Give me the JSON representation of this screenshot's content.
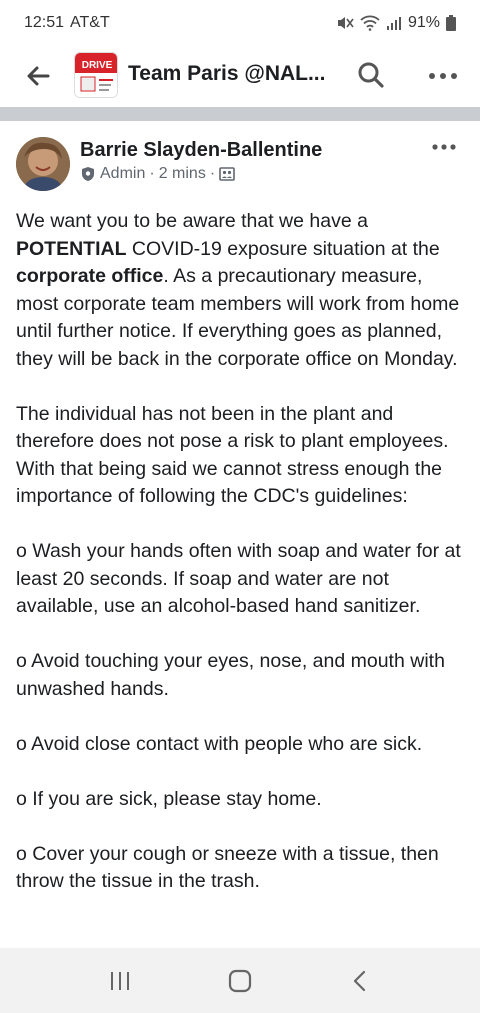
{
  "status_bar": {
    "time": "12:51",
    "carrier": "AT&T",
    "battery": "91%"
  },
  "app_bar": {
    "group_title": "Team Paris @NAL...",
    "group_thumb_text": "DRIVE"
  },
  "post": {
    "author": "Barrie Slayden-Ballentine",
    "role": "Admin",
    "time": "2 mins",
    "paragraphs": [
      {
        "pre": "We want you to be aware that we have a ",
        "b1": "POTENTIAL",
        "mid": " COVID-19 exposure situation at the ",
        "b2": "corporate office",
        "post": ".  As a precautionary measure, most corporate team members will work from home until further notice.  If everything goes as planned, they will be back in the corporate office on Monday."
      },
      {
        "text": "The individual has not been in the plant and therefore does not pose a risk to plant employees. With that being said we cannot stress enough the importance of following the CDC's guidelines:"
      },
      {
        "text": "o Wash your hands often with soap and water for at least 20 seconds. If soap and water are not available, use an alcohol-based hand sanitizer."
      },
      {
        "text": "o Avoid touching your eyes, nose, and mouth with unwashed hands."
      },
      {
        "text": "o Avoid close contact with people who are sick."
      },
      {
        "text": "o If you are sick, please stay home."
      },
      {
        "text": "o Cover your cough or sneeze with a tissue, then throw the tissue in the trash."
      }
    ]
  },
  "colors": {
    "divider": "#c9ccd1",
    "text": "#1c1e21",
    "meta": "#606770",
    "nav_bg": "#f2f2f2"
  },
  "icons": {
    "back": "arrow-left-icon",
    "search": "search-icon",
    "more": "more-horizontal-icon",
    "admin": "shield-icon",
    "audience": "group-audience-icon",
    "nav_recent": "recents-icon",
    "nav_home": "home-icon",
    "nav_back": "back-chevron-icon"
  }
}
